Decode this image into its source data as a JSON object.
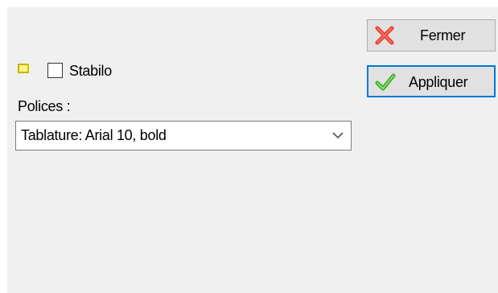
{
  "buttons": {
    "close_label": "Fermer",
    "close_icon": "red-x-icon",
    "apply_label": "Appliquer",
    "apply_icon": "green-check-icon"
  },
  "highlight": {
    "checkbox_label": "Stabilo",
    "checked": false,
    "swatch_icon": "highlight-color-swatch",
    "swatch_color": "#fff48a"
  },
  "fonts": {
    "label": "Polices :",
    "selected": "Tablature: Arial 10, bold",
    "dropdown_icon": "chevron-down-icon"
  },
  "colors": {
    "dialog_bg": "#f0f0f0",
    "focus_border": "#0078d7",
    "close_icon": "#e23b2e",
    "apply_icon": "#3fae2a"
  }
}
